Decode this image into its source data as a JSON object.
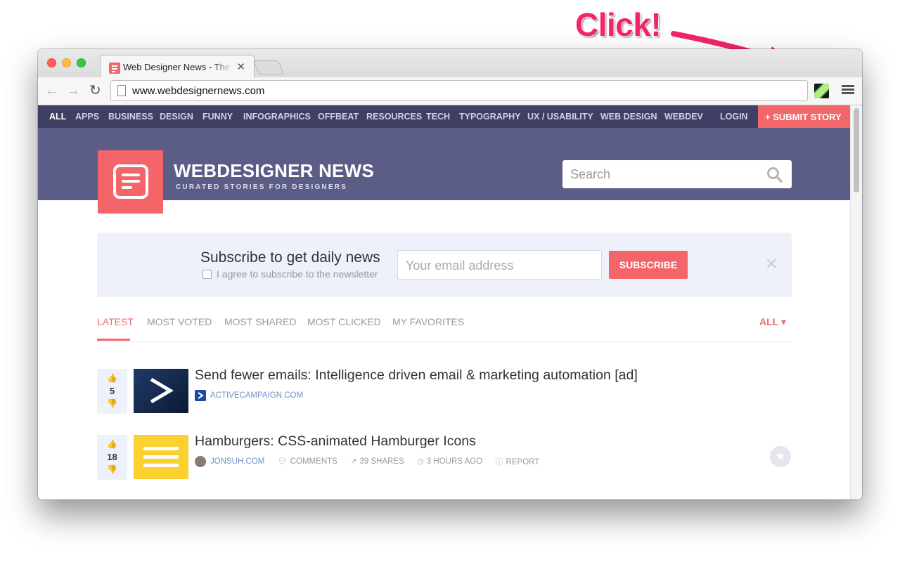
{
  "annotation": {
    "text": "Click!",
    "color": "#f2246e"
  },
  "browser": {
    "tab": {
      "title": "Web Designer News - The ",
      "close": "✕"
    },
    "nav": {
      "back": "←",
      "forward": "→",
      "reload": "↻"
    },
    "url": "www.webdesignernews.com"
  },
  "site": {
    "categories": [
      {
        "label": "ALL",
        "active": true
      },
      {
        "label": "APPS"
      },
      {
        "label": "BUSINESS"
      },
      {
        "label": "DESIGN"
      },
      {
        "label": "FUNNY"
      },
      {
        "label": "INFOGRAPHICS"
      },
      {
        "label": "OFFBEAT"
      },
      {
        "label": "RESOURCES"
      },
      {
        "label": "TECH"
      },
      {
        "label": "TYPOGRAPHY"
      },
      {
        "label": "UX / USABILITY"
      },
      {
        "label": "WEB DESIGN"
      },
      {
        "label": "WEBDEV"
      }
    ],
    "login": "LOGIN",
    "submit": "+ SUBMIT STORY",
    "brand": "WEBDESIGNER NEWS",
    "tagline": "CURATED STORIES FOR DESIGNERS",
    "search_placeholder": "Search",
    "colors": {
      "nav": "#3e3f63",
      "hero": "#5b5d87",
      "accent": "#f2676a"
    }
  },
  "subscribe": {
    "title": "Subscribe to get daily news",
    "agree": "I agree to subscribe to the newsletter",
    "email_placeholder": "Your email address",
    "button": "SUBSCRIBE",
    "close": "✕"
  },
  "sort": {
    "tabs": [
      "LATEST",
      "MOST VOTED",
      "MOST SHARED",
      "MOST CLICKED",
      "MY FAVORITES"
    ],
    "active": "LATEST",
    "filter": "ALL ▾"
  },
  "stories": [
    {
      "votes": "5",
      "title": "Send fewer emails: Intelligence driven email & marketing automation [ad]",
      "source": "ACTIVECAMPAIGN.COM",
      "thumb_icon": "chevron-right-icon"
    },
    {
      "votes": "18",
      "title": "Hamburgers: CSS-animated Hamburger Icons",
      "source": "JONSUH.COM",
      "comments": "COMMENTS",
      "shares": "39 SHARES",
      "time": "3 HOURS AGO",
      "report": "REPORT",
      "thumb_icon": "hamburger-icon"
    }
  ]
}
